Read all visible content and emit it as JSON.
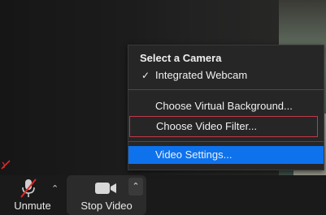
{
  "menu": {
    "title": "Select a Camera",
    "items": [
      {
        "label": "Integrated Webcam",
        "checked": true
      },
      {
        "label": "Choose Virtual Background..."
      },
      {
        "label": "Choose Video Filter..."
      },
      {
        "label": "Video Settings..."
      }
    ]
  },
  "toolbar": {
    "unmute_label": "Unmute",
    "stop_video_label": "Stop Video"
  },
  "colors": {
    "highlight": "#0e72ed",
    "outline": "#c0394a",
    "mute_slash": "#e02828"
  },
  "icons": {
    "checkmark": "check-icon",
    "mic": "microphone-muted-icon",
    "camera": "video-camera-icon",
    "caret": "caret-up-icon"
  }
}
